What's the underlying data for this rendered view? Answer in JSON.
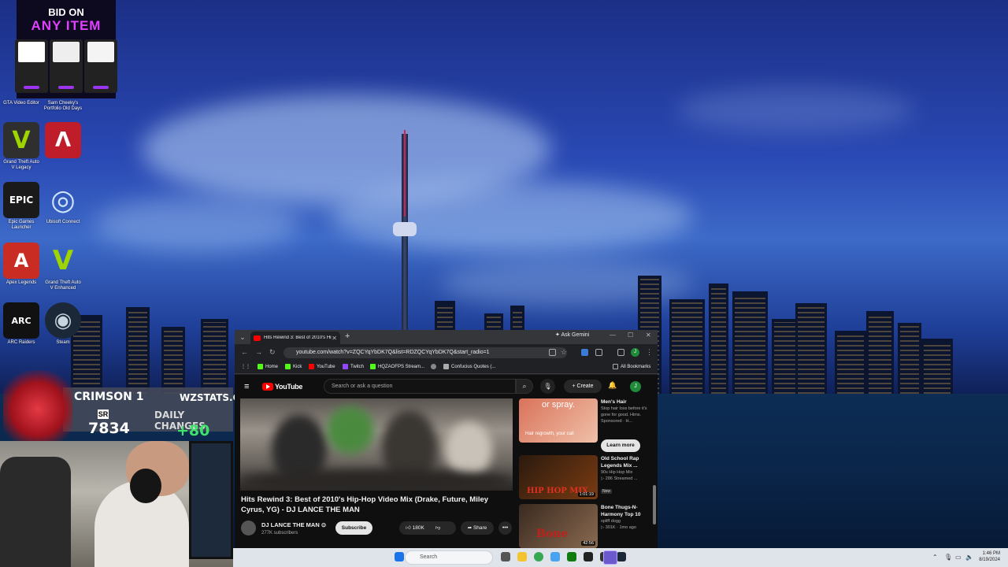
{
  "desktop": {
    "icons": [
      {
        "label": "GTA Video Editor",
        "glyph": "V",
        "color": "#2f2f2f",
        "fg": "#9fd400"
      },
      {
        "label": "Sam Cheeky's Portfolio Old Days",
        "glyph": "",
        "color": "#222222",
        "fg": "#ffffff"
      },
      {
        "label": "Grand Theft Auto V Legacy",
        "glyph": "V",
        "color": "#2f2f2f",
        "fg": "#9fd400"
      },
      {
        "label": "",
        "glyph": "Λ",
        "color": "#c01d2b",
        "fg": "#ffffff"
      },
      {
        "label": "Epic Games Launcher",
        "glyph": "EPIC",
        "color": "#1a1a1a",
        "fg": "#ffffff"
      },
      {
        "label": "Ubisoft Connect",
        "glyph": "◎",
        "color": "#1e2a3a",
        "fg": "#cde3ff"
      },
      {
        "label": "Apex Legends",
        "glyph": "A",
        "color": "#c92c22",
        "fg": "#ffffff"
      },
      {
        "label": "Grand Theft Auto V Enhanced",
        "glyph": "V",
        "color": "#2f2f2f",
        "fg": "#9fd400"
      },
      {
        "label": "ARC Raiders",
        "glyph": "ARC",
        "color": "#111111",
        "fg": "#ffffff"
      },
      {
        "label": "Steam",
        "glyph": "◉",
        "color": "#1b2838",
        "fg": "#c7d5e0"
      }
    ]
  },
  "ad": {
    "line1": "BID ON",
    "line2": "ANY ITEM"
  },
  "stats_overlay": {
    "rank_name": "CRIMSON 1",
    "site": "WZSTATS.GG",
    "sr_label": "SR",
    "sr_value": "7834",
    "daily_label": "DAILY CHANGES",
    "daily_value": "+80"
  },
  "browser": {
    "tab_title": "Hits Rewind 3: Best of 2010's Hip-Hop",
    "ask_gemini": "Ask Gemini",
    "url": "youtube.com/watch?v=ZQCYqYbDK7Q&list=RDZQCYqYbDK7Q&start_radio=1",
    "profile_initial": "J",
    "bookmarks": [
      {
        "label": "Home",
        "color": "#53fc18"
      },
      {
        "label": "Kick",
        "color": "#53fc18"
      },
      {
        "label": "YouTube",
        "color": "#ff0000"
      },
      {
        "label": "Twitch",
        "color": "#9146ff"
      },
      {
        "label": "HQZAOFPS Stream...",
        "color": "#53fc18"
      },
      {
        "label": "",
        "color": "#888888"
      },
      {
        "label": "Confucius Quotes (...",
        "color": "#aaaaaa"
      }
    ],
    "all_bookmarks": "All Bookmarks"
  },
  "youtube": {
    "logo": "YouTube",
    "search_placeholder": "Search or ask a question",
    "create_label": "+ Create",
    "avatar_initial": "J",
    "video_title": "Hits Rewind 3: Best of 2010's Hip-Hop Video Mix (Drake, Future, Miley Cyrus, YG) - DJ LANCE THE MAN",
    "channel_name": "DJ LANCE THE MAN ⊙",
    "subscribers": "277K subscribers",
    "subscribe_label": "Subscribe",
    "likes": "180K",
    "share_label": "Share",
    "recommendations": [
      {
        "title": "Men's Hair",
        "meta1": "Stop hair loss before it's gone for good. Hims.",
        "meta2": "Sponsored · H...",
        "duration": "",
        "thumb_text": "or spray.",
        "thumb_sub": "Hair regrowth, your call",
        "is_ad": true
      },
      {
        "title": "Old School Rap Legends Mix ...",
        "meta1": "90s Hip Hop Mix",
        "meta2": "▷ 286 Streamed ...",
        "badge": "New",
        "duration": "1:01:19",
        "thumb_text": "HIP HOP MIX"
      },
      {
        "title": "Bone Thugs-N-Harmony Top 10",
        "meta1": "spliff dogg",
        "meta2": "▷ 301K · 1mo ago",
        "duration": "42:56",
        "thumb_text": "Bone"
      }
    ],
    "learn_more": "Learn more"
  },
  "taskbar": {
    "search_placeholder": "Search",
    "time": "1:46 PM",
    "date": "8/19/2024"
  }
}
